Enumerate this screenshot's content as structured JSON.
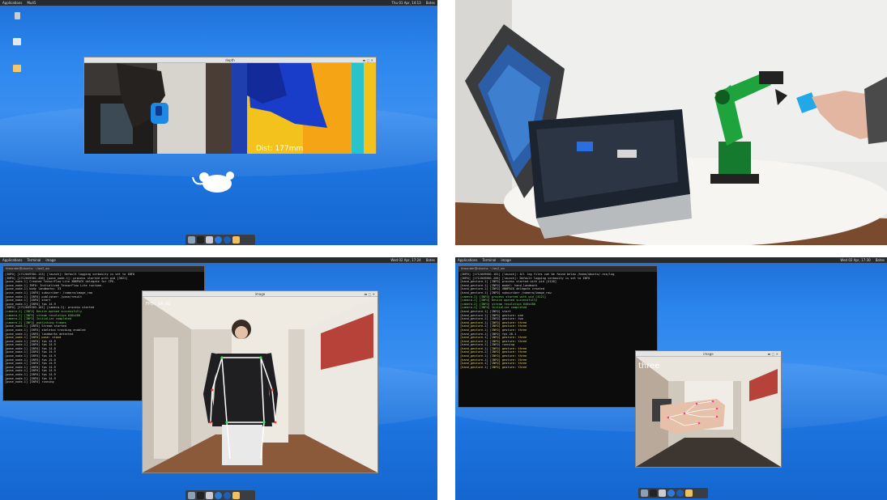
{
  "q1": {
    "topbar": {
      "apps": "Applications",
      "tab": "Mu45",
      "clock": "Thu 01 Apr, 14:13",
      "user": "Bates"
    },
    "window_title": "depth",
    "dist_label": "Dist: 177mm",
    "icons": [
      "Trash",
      "Home",
      "Files"
    ]
  },
  "q2": {
    "caption": ""
  },
  "q3": {
    "topbar": {
      "apps": "Applications",
      "tab1": "Terminal",
      "tab2": "image",
      "clock": "Wed 02 Apr, 17:24",
      "user": "Bates"
    },
    "terminal_title": "hiwonder@ubuntu: ~/ros2_ws",
    "window_title": "image",
    "fps": "FPS: 14.92",
    "terminal_lines": [
      "[INFO] [1712049301.123] [launch]: Default logging verbosity is set to INFO",
      "[INFO] [1712049301.456] [pose_node-1]: process started with pid [3021]",
      "[pose_node-1] Created TensorFlow Lite XNNPACK delegate for CPU.",
      "[pose_node-1] INFO: Initialized TensorFlow Lite runtime.",
      "[pose_node-1] body landmarks: 33",
      "[pose_node-1] [INFO] subscriber: /camera/image_raw",
      "[pose_node-1] [INFO] publisher: /pose/result",
      "[pose_node-1] [INFO] start",
      "[pose_node-1] [INFO] fps 14.9",
      "[INFO] [1712049303.101] [camera-2]: process started",
      "[camera-2] [INFO] Device opened successfully",
      "[camera-2] [INFO] stream resolution 640x480",
      "[camera-2] [INFO] Initialize completed",
      "[camera-2] [INFO] publishing frames",
      "[pose_node-1] [INFO] Stream started",
      "[pose_node-1] [INFO] skeleton tracking enabled",
      "[pose_node-1] [INFO] landmarks detected",
      "[pose_node-1] [INFO] pose: stand",
      "[pose_node-1] [INFO] fps 14.9",
      "[pose_node-1] [INFO] fps 14.9",
      "[pose_node-1] [INFO] fps 14.8",
      "[pose_node-1] [INFO] fps 14.9",
      "[pose_node-1] [INFO] fps 14.9",
      "[pose_node-1] [INFO] fps 15.0",
      "[pose_node-1] [INFO] fps 14.9",
      "[pose_node-1] [INFO] fps 14.9",
      "[pose_node-1] [INFO] fps 14.9",
      "[pose_node-1] [INFO] fps 14.9",
      "[pose_node-1] [INFO] fps 14.9",
      "[pose_node-1] [INFO] running"
    ]
  },
  "q4": {
    "topbar": {
      "apps": "Applications",
      "tab1": "Terminal",
      "tab2": "image",
      "clock": "Wed 02 Apr, 17:30",
      "user": "Bates"
    },
    "terminal_title": "hiwonder@ubuntu: ~/ros2_ws",
    "window_title": "image",
    "gesture": "three",
    "terminal_lines": [
      "[INFO] [1712049601.101] [launch]: All log files can be found below /home/ubuntu/.ros/log",
      "[INFO] [1712049601.205] [launch]: Default logging verbosity is set to INFO",
      "[hand_gesture-1] [INFO] process started with pid [4120]",
      "[hand_gesture-1] [INFO] model: hand_landmark",
      "[hand_gesture-1] [INFO] XNNPACK delegate created",
      "[hand_gesture-1] [INFO] subscriber /camera/image_raw",
      "[camera-2] [INFO] process started with pid [4121]",
      "[camera-2] [INFO] Device opened successfully",
      "[camera-2] [INFO] stream resolution 640x480",
      "[camera-2] [INFO] Initialize completed",
      "[hand_gesture-1] [INFO] start",
      "[hand_gesture-1] [INFO] gesture: one",
      "[hand_gesture-1] [INFO] gesture: two",
      "[hand_gesture-1] [INFO] gesture: three",
      "[hand_gesture-1] [INFO] gesture: three",
      "[hand_gesture-1] [INFO] gesture: three",
      "[hand_gesture-1] [INFO] fps 20.1",
      "[hand_gesture-1] [INFO] gesture: three",
      "[hand_gesture-1] [INFO] gesture: three",
      "[hand_gesture-1] [INFO] running",
      "[hand_gesture-1] [INFO] gesture: three",
      "[hand_gesture-1] [INFO] gesture: three",
      "[hand_gesture-1] [INFO] gesture: three",
      "[hand_gesture-1] [INFO] gesture: three",
      "[hand_gesture-1] [INFO] gesture: three",
      "[hand_gesture-1] [INFO] gesture: three"
    ]
  }
}
